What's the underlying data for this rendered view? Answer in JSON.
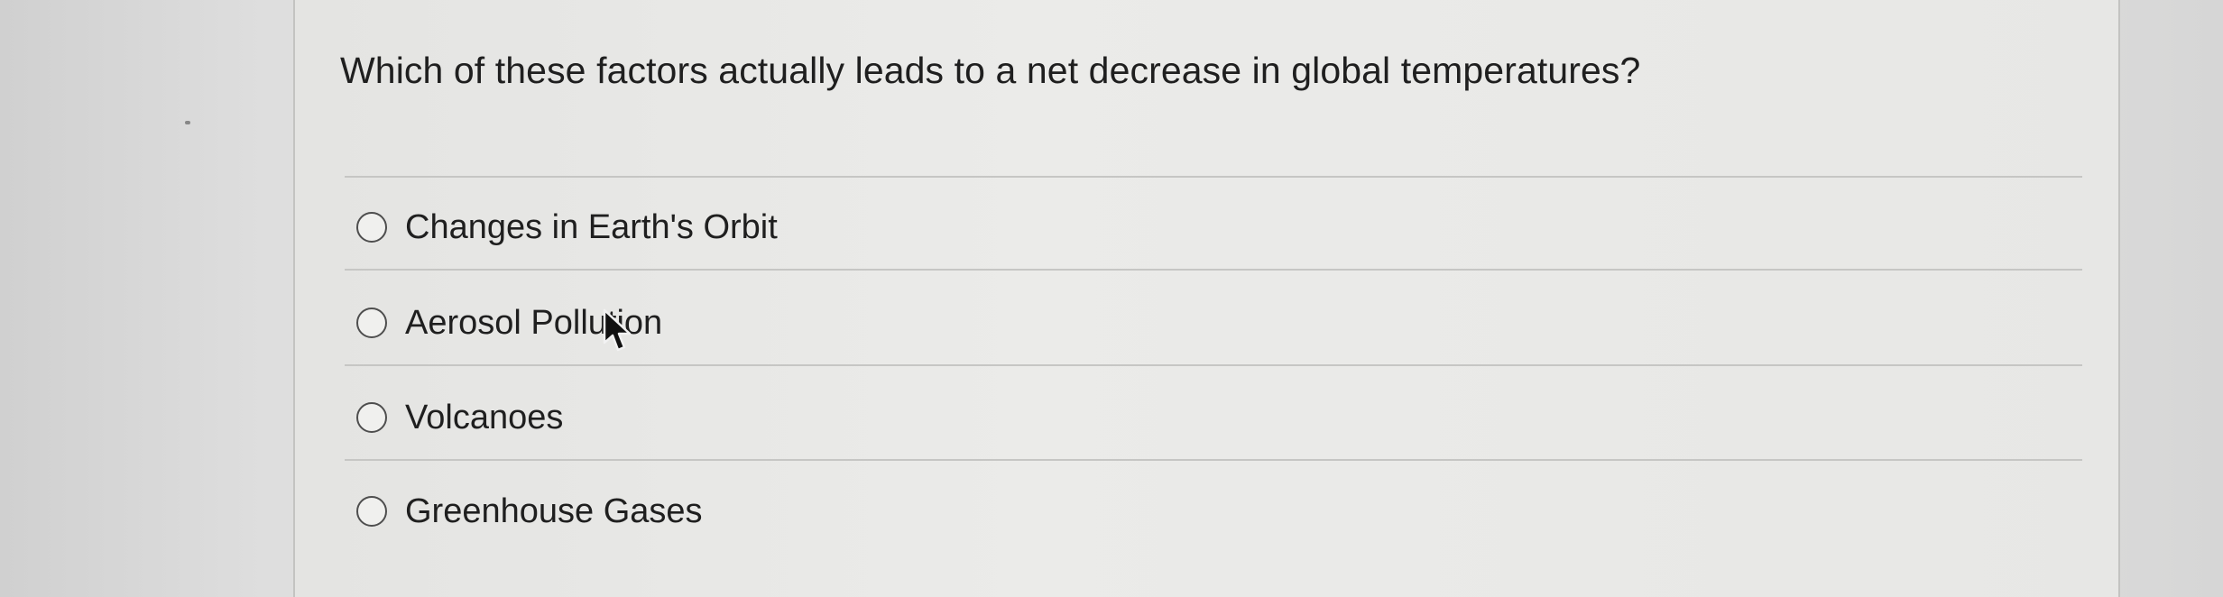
{
  "question": {
    "text": "Which of these factors actually leads to a net decrease in global temperatures?"
  },
  "choices": [
    {
      "label": "Changes in Earth's Orbit",
      "selected": false
    },
    {
      "label": "Aerosol Pollution",
      "selected": false
    },
    {
      "label": "Volcanoes",
      "selected": false
    },
    {
      "label": "Greenhouse Gases",
      "selected": false
    }
  ],
  "icons": {
    "radio": "radio-button-icon",
    "cursor": "mouse-pointer-icon"
  }
}
